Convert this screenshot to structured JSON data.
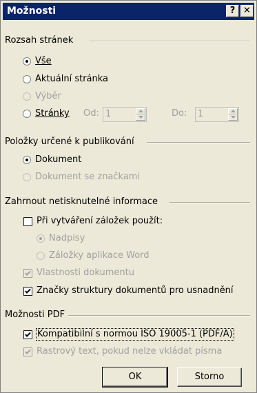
{
  "dialog": {
    "title": "Možnosti",
    "help_button": "?",
    "close_button": "✕"
  },
  "page_range": {
    "heading": "Rozsah stránek",
    "all_label": "Vše",
    "all_selected": true,
    "current_label": "Aktuální stránka",
    "selection_label": "Výběr",
    "pages_label": "Stránky",
    "from_label": "Od:",
    "from_value": "1",
    "to_label": "Do:",
    "to_value": "1"
  },
  "publish": {
    "heading": "Položky určené k publikování",
    "document_label": "Dokument",
    "document_selected": true,
    "document_markup_label": "Dokument se značkami"
  },
  "nonprint": {
    "heading": "Zahrnout netisknutelné informace",
    "bookmarks_label": "Při vytváření záložek použít:",
    "bookmarks_checked": false,
    "headings_label": "Nadpisy",
    "headings_selected": true,
    "word_bookmarks_label": "Záložky aplikace Word",
    "doc_props_label": "Vlastnosti dokumentu",
    "doc_props_checked": true,
    "struct_tags_label": "Značky struktury dokumentů pro usnadnění",
    "struct_tags_checked": true
  },
  "pdf": {
    "heading": "Možnosti PDF",
    "iso_label": "Kompatibilní s normou ISO 19005-1 (PDF/A)",
    "iso_checked": true,
    "bitmap_label": "Rastrový text, pokud nelze vkládat písma",
    "bitmap_checked": true
  },
  "buttons": {
    "ok": "OK",
    "cancel": "Storno"
  }
}
